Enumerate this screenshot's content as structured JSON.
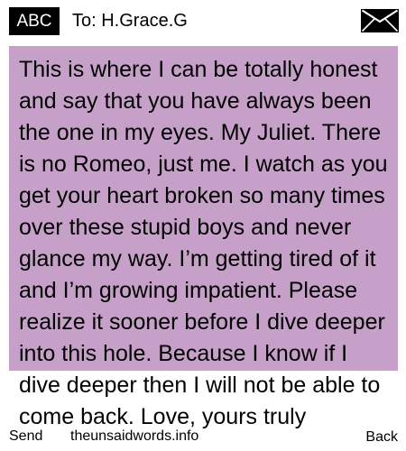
{
  "header": {
    "input_mode": "ABC",
    "recipient": "To: H.Grace.G",
    "icon": "envelope-icon"
  },
  "message": {
    "text": "This is where I can be totally honest and say that you have always been the one in my eyes. My Juliet. There is no Romeo, just me. I watch as you get your heart broken so many times over these stupid boys and never glance my way. I’m getting tired of it and I’m growing impatient. Please realize it sooner before I dive deeper into this hole. Because I know if I dive deeper then I will not be able to come back. Love, yours truly"
  },
  "softkeys": {
    "left": "Send",
    "center": "theunsaidwords.info",
    "right": "Back"
  },
  "colors": {
    "panel": "#c6a0c9",
    "badge": "#000000"
  }
}
